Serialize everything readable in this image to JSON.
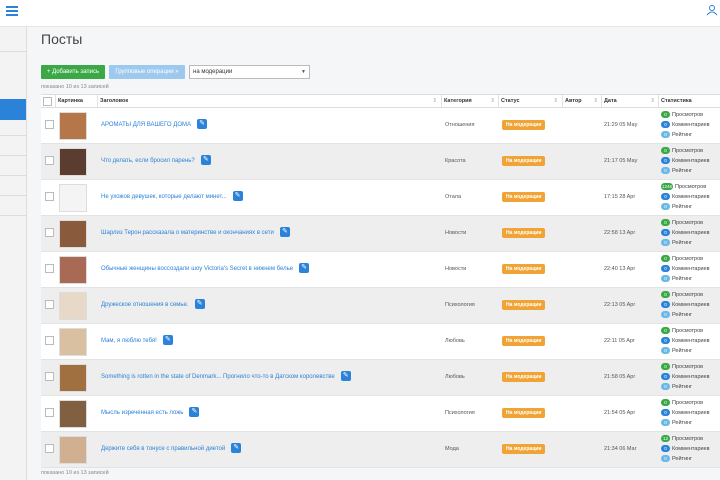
{
  "header": {
    "title": "Посты"
  },
  "toolbar": {
    "add_label": "+ Добавить запись",
    "group_label": "Групповые операции »",
    "filter_value": "на модерации"
  },
  "count_text_top": "показано 10 из 13 записей",
  "count_text_bottom": "показано 10 из 13 записей",
  "columns": [
    "Картинка",
    "Заголовок",
    "Категория",
    "Статус",
    "Автор",
    "Дата",
    "Статистика"
  ],
  "stat_labels": {
    "views": "Просмотров",
    "comments": "Комментариев",
    "rating": "Рейтинг"
  },
  "status_label": "На модерации",
  "rows": [
    {
      "title": "АРОМАТЫ ДЛЯ ВАШЕГО ДОМА",
      "category": "Отношения",
      "date": "21:29 05 May",
      "views": "0",
      "comments": "0",
      "rating": "0"
    },
    {
      "title": "Что делать, если бросил парень?",
      "category": "Красота",
      "date": "21:17 05 May",
      "views": "0",
      "comments": "0",
      "rating": "0"
    },
    {
      "title": "Не ухожов девушек, которые делают минет...",
      "category": "Отала",
      "date": "17:15 28 Apr",
      "views": "1246",
      "comments": "0",
      "rating": "0"
    },
    {
      "title": "Шарлиз Терон рассказала о материнстве и окончаниях в сети",
      "category": "Новости",
      "date": "22:58 13 Apr",
      "views": "0",
      "comments": "0",
      "rating": "0"
    },
    {
      "title": "Обычные женщины воссоздали шоу Victoria's Secret в нижнем белье",
      "category": "Новости",
      "date": "22:40 13 Apr",
      "views": "0",
      "comments": "0",
      "rating": "0"
    },
    {
      "title": "Дружеское отношения в семье.",
      "category": "Психология",
      "date": "22:13 05 Apr",
      "views": "0",
      "comments": "0",
      "rating": "0"
    },
    {
      "title": "Мам, я люблю тебя!",
      "category": "Любовь",
      "date": "22:11 05 Apr",
      "views": "0",
      "comments": "0",
      "rating": "0"
    },
    {
      "title": "Something is rotten in the state of Denmark... Прогнило что-то в Датском королевстве",
      "category": "Любовь",
      "date": "21:58 05 Apr",
      "views": "0",
      "comments": "0",
      "rating": "0"
    },
    {
      "title": "Мысль изреченная есть ложь",
      "category": "Психология",
      "date": "21:54 05 Apr",
      "views": "0",
      "comments": "0",
      "rating": "0"
    },
    {
      "title": "Держите себя в тонусе с правильной диетой",
      "category": "Мода",
      "date": "21:34 06 Mar",
      "views": "12",
      "comments": "0",
      "rating": "0"
    }
  ],
  "colors": {
    "accent": "#2b82d9",
    "success": "#3aa845",
    "warning": "#f0a436",
    "info": "#69b8e8"
  }
}
